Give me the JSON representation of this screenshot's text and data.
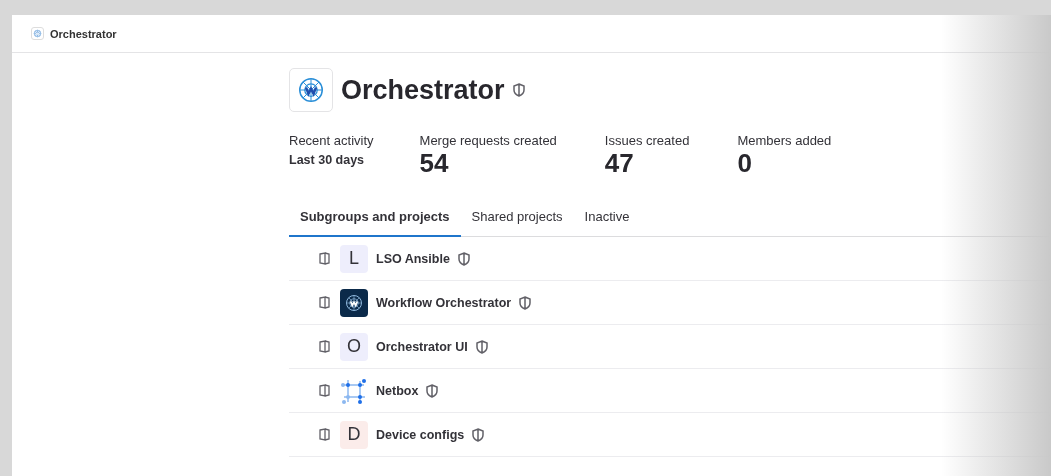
{
  "breadcrumb": {
    "title": "Orchestrator"
  },
  "group": {
    "name": "Orchestrator"
  },
  "activity": {
    "label": "Recent activity",
    "period": "Last 30 days",
    "stats": [
      {
        "label": "Merge requests created",
        "value": "54"
      },
      {
        "label": "Issues created",
        "value": "47"
      },
      {
        "label": "Members added",
        "value": "0"
      }
    ]
  },
  "tabs": [
    {
      "label": "Subgroups and projects",
      "selected": true
    },
    {
      "label": "Shared projects",
      "selected": false
    },
    {
      "label": "Inactive",
      "selected": false
    }
  ],
  "projects": [
    {
      "name": "LSO Ansible",
      "kind": "letter",
      "avatar": "L",
      "color": "#eeeefc"
    },
    {
      "name": "Workflow Orchestrator",
      "kind": "logo"
    },
    {
      "name": "Orchestrator UI",
      "kind": "letter",
      "avatar": "O",
      "color": "#eeeefc"
    },
    {
      "name": "Netbox",
      "kind": "graph"
    },
    {
      "name": "Device configs",
      "kind": "letter",
      "avatar": "D",
      "color": "#fbecea"
    }
  ]
}
